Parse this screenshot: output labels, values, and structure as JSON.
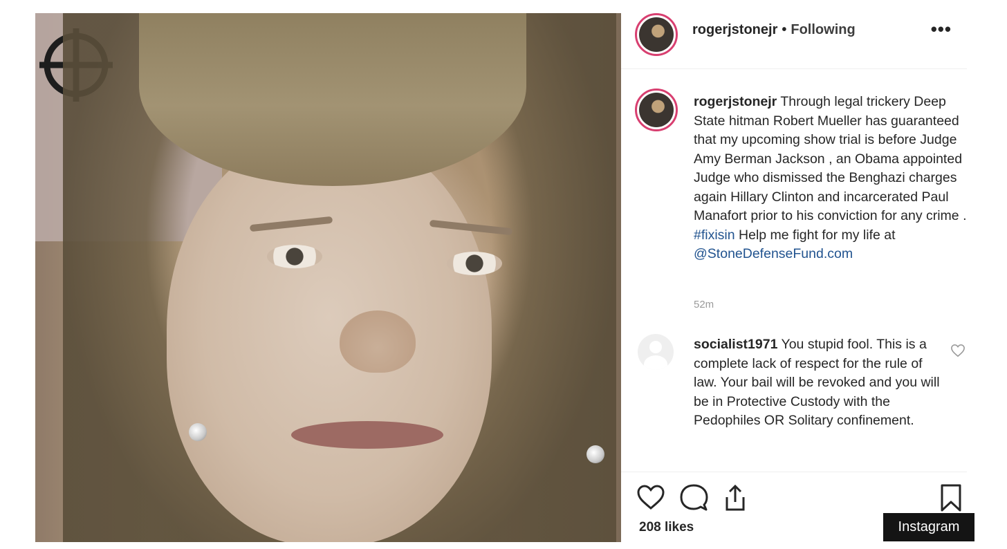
{
  "post": {
    "header": {
      "username": "rogerjstonejr",
      "separator": "•",
      "follow_status": "Following",
      "more_label": "•••"
    },
    "caption": {
      "username": "rogerjstonejr",
      "text_before_hashtag": "Through legal trickery Deep State hitman Robert Mueller has guaranteed that my upcoming show trial is before Judge Amy Berman Jackson , an Obama appointed Judge who dismissed the Benghazi charges again Hillary Clinton and incarcerated Paul Manafort prior to his conviction for any crime .",
      "hashtag": "#fixisin",
      "text_after_hashtag": "Help me fight for my life at",
      "mention": "@StoneDefenseFund.com"
    },
    "timestamp": "52m",
    "comment": {
      "username": "socialist1971",
      "text": "You stupid fool. This is a complete lack of respect for the rule of law. Your bail will be revoked and you will be in Protective Custody with the Pedophiles OR Solitary confinement."
    },
    "likes": "208 likes",
    "icons": {
      "like": "heart-icon",
      "comment": "comment-bubble-icon",
      "share": "share-icon",
      "save": "bookmark-icon",
      "comment_like": "heart-icon"
    }
  },
  "source_label": "Instagram",
  "colors": {
    "link": "#21538f",
    "avatar_ring": "#d83f70",
    "text": "#262626",
    "timestamp": "#9a9a9a"
  }
}
